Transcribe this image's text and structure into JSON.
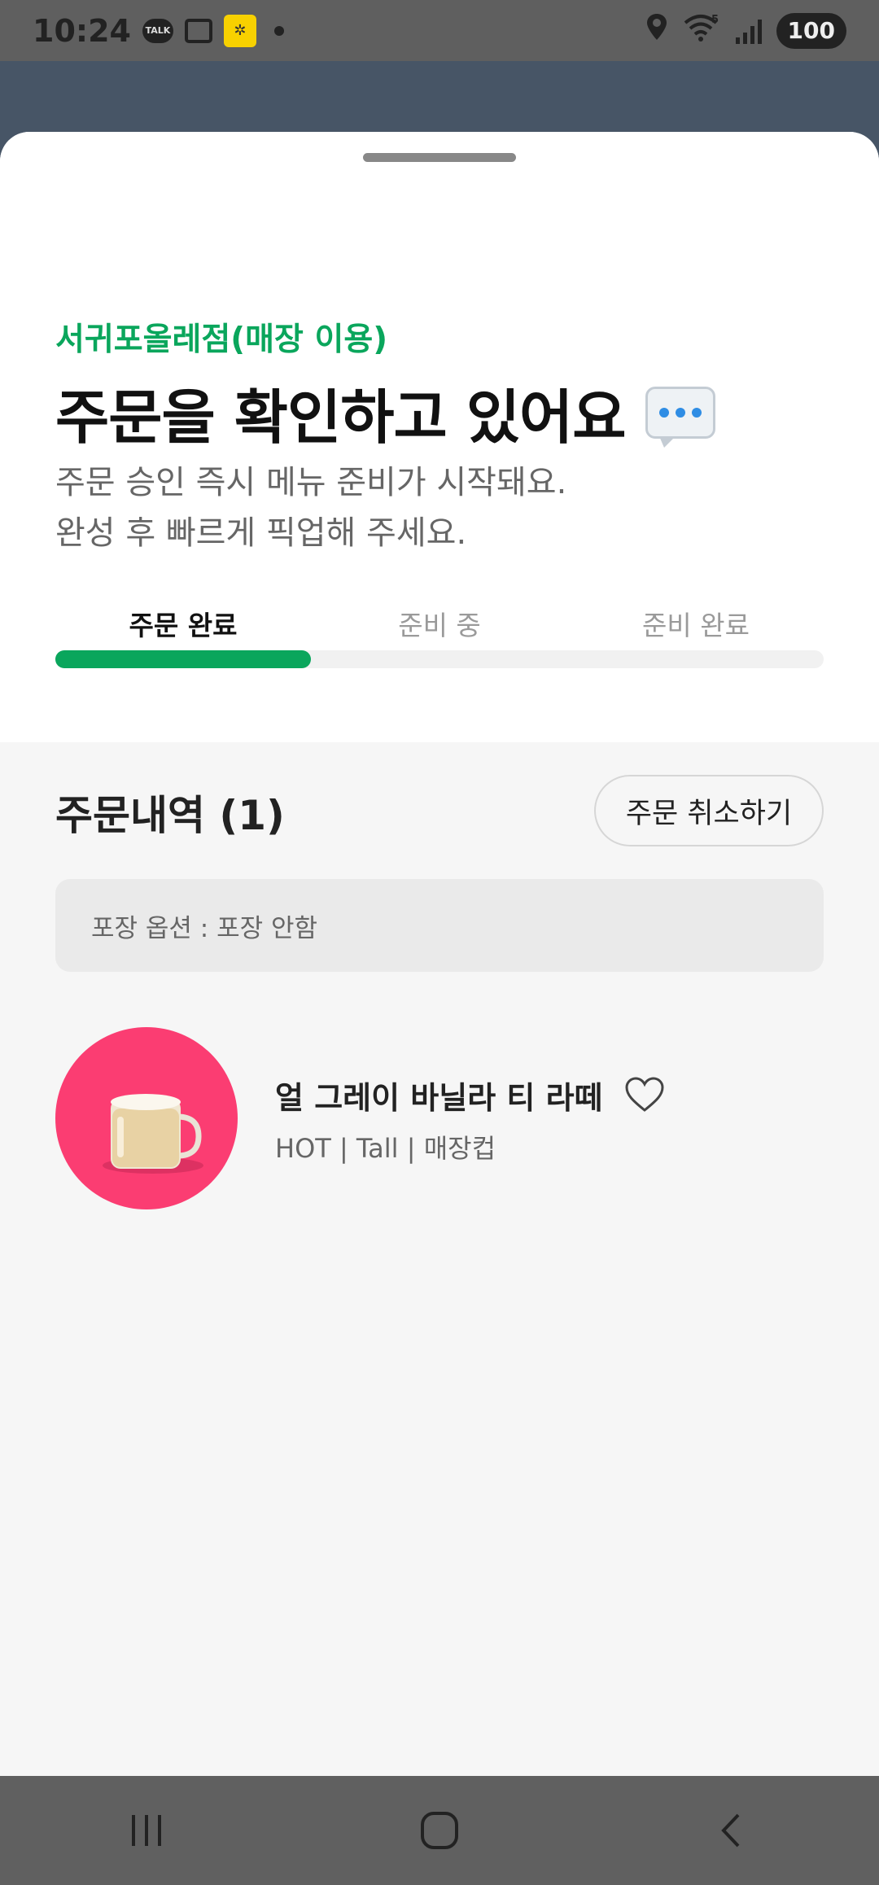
{
  "status_bar": {
    "time": "10:24",
    "talk_label": "TALK",
    "battery": "100",
    "network_badge": "5"
  },
  "sheet": {
    "store_name": "서귀포올레점(매장 이용)",
    "headline": "주문을 확인하고 있어요",
    "description_line1": "주문 승인 즉시 메뉴 준비가 시작돼요.",
    "description_line2": "완성 후 빠르게 픽업해 주세요.",
    "steps": [
      {
        "label": "주문 완료",
        "active": true
      },
      {
        "label": "준비 중",
        "active": false
      },
      {
        "label": "준비 완료",
        "active": false
      }
    ],
    "progress_fraction": 0.333,
    "accent_color": "#0aa65c"
  },
  "order_history": {
    "title": "주문내역 (1)",
    "cancel_label": "주문 취소하기",
    "packaging_option": "포장 옵션 : 포장 안함",
    "items": [
      {
        "name": "얼 그레이 바닐라 티 라떼",
        "options": "HOT | Tall | 매장컵",
        "thumb_bg": "#fb3d72",
        "favorite": false
      }
    ]
  },
  "icons": {
    "location": "location-icon",
    "wifi": "wifi-icon",
    "signal": "signal-icon",
    "heart": "heart-outline-icon",
    "chat_bubble": "speech-bubble-icon"
  }
}
